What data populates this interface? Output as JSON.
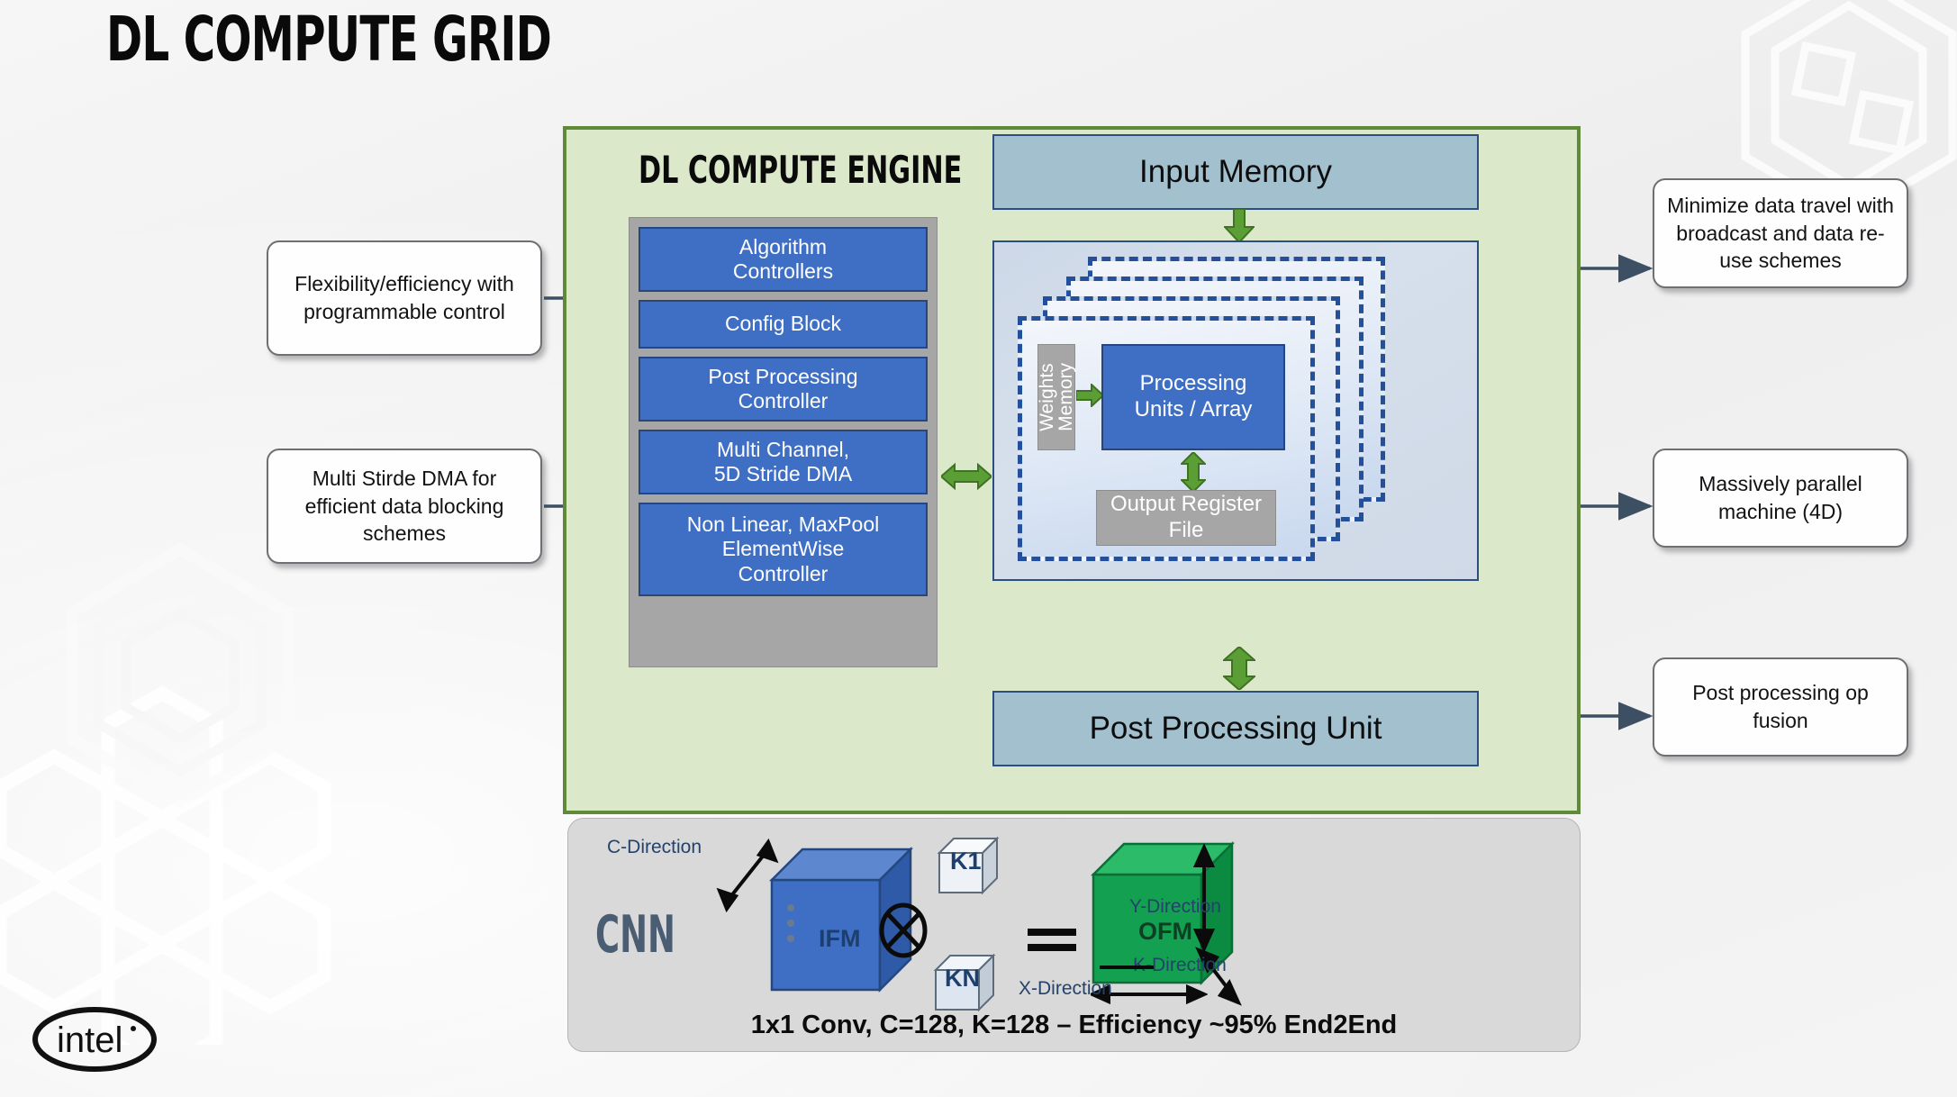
{
  "slide": {
    "title": "DL COMPUTE GRID",
    "brand_logo": "intel-logo",
    "background": "#f2f2f2"
  },
  "engine": {
    "title": "DL COMPUTE ENGINE",
    "fill": "#dbe8c9",
    "border": "#5f8a38",
    "controllers": [
      {
        "label": "Algorithm\nControllers",
        "name": "algorithm-controllers"
      },
      {
        "label": "Config Block",
        "name": "config-block"
      },
      {
        "label": "Post Processing\nController",
        "name": "post-processing-controller"
      },
      {
        "label": "Multi Channel,\n5D Stride DMA",
        "name": "multi-channel-5d-stride-dma"
      },
      {
        "label": "Non Linear, MaxPool\nElementWise\nController",
        "name": "non-linear-maxpool-elementwise-controller"
      }
    ],
    "input_memory": "Input Memory",
    "post_processing_unit": "Post Processing Unit",
    "array": {
      "weights_memory": "Weights\nMemory",
      "processing_units": "Processing\nUnits / Array",
      "output_register_file": "Output Register\nFile",
      "layer_count": 4
    },
    "accent_blue": "#3f6fc4",
    "accent_green_arrow": "#5a9e35",
    "memory_bar_fill": "#a3c0cf",
    "gray_block_fill": "#a6a6a6"
  },
  "callouts": {
    "flexibility": "Flexibility/efficiency with programmable control",
    "dma": "Multi Stirde DMA for efficient data blocking schemes",
    "minimize": "Minimize data travel with broadcast and data re-use schemes",
    "parallel": "Massively parallel machine (4D)",
    "fusion": "Post processing op fusion"
  },
  "cnn": {
    "label": "CNN",
    "ifm_label": "IFM",
    "ofm_label": "OFM",
    "kernel_first": "K1",
    "kernel_last": "KN",
    "operator": "conv-operator-icon",
    "equals": "equals-icon",
    "directions": {
      "c": "C-Direction",
      "x": "X-Direction",
      "y": "Y-Direction",
      "k": "K-Direction"
    },
    "caption": "1x1 Conv, C=128, K=128 – Efficiency ~95% End2End",
    "ifm_color": "#3f6fc4",
    "ofm_color": "#13a050",
    "panel_fill": "#d9d9d9"
  }
}
